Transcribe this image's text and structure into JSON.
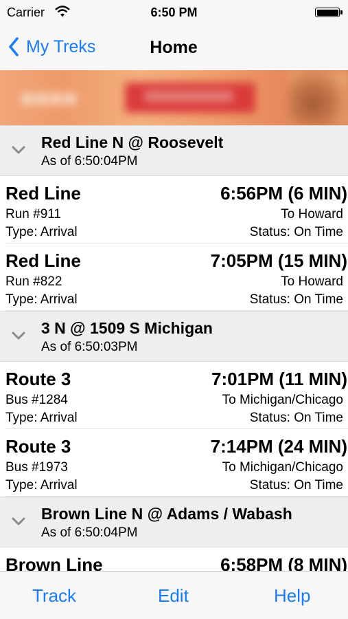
{
  "status_bar": {
    "carrier": "Carrier",
    "time": "6:50 PM"
  },
  "nav": {
    "back_label": "My Treks",
    "title": "Home"
  },
  "sections": [
    {
      "title": "Red Line N @ Roosevelt",
      "updated": "As of 6:50:04PM",
      "arrivals": [
        {
          "line": "Red Line",
          "time": "6:56PM (6 MIN)",
          "vehicle": "Run #911",
          "destination": "To Howard",
          "type": "Type: Arrival",
          "status": "Status: On Time"
        },
        {
          "line": "Red Line",
          "time": "7:05PM (15 MIN)",
          "vehicle": "Run #822",
          "destination": "To Howard",
          "type": "Type: Arrival",
          "status": "Status: On Time"
        }
      ]
    },
    {
      "title": "3 N @ 1509 S Michigan",
      "updated": "As of 6:50:03PM",
      "arrivals": [
        {
          "line": "Route 3",
          "time": "7:01PM (11 MIN)",
          "vehicle": "Bus #1284",
          "destination": "To Michigan/Chicago",
          "type": "Type: Arrival",
          "status": "Status: On Time"
        },
        {
          "line": "Route 3",
          "time": "7:14PM (24 MIN)",
          "vehicle": "Bus #1973",
          "destination": "To Michigan/Chicago",
          "type": "Type: Arrival",
          "status": "Status: On Time"
        }
      ]
    },
    {
      "title": "Brown Line N @ Adams / Wabash",
      "updated": "As of 6:50:04PM",
      "arrivals": [
        {
          "line": "Brown Line",
          "time": "6:58PM (8 MIN)",
          "vehicle": "",
          "destination": "",
          "type": "",
          "status": ""
        }
      ]
    }
  ],
  "tab_bar": {
    "track": "Track",
    "edit": "Edit",
    "help": "Help"
  },
  "colors": {
    "accent": "#1a7cf5",
    "section_bg": "#eeeeee",
    "bar_bg": "#f7f7f7"
  }
}
